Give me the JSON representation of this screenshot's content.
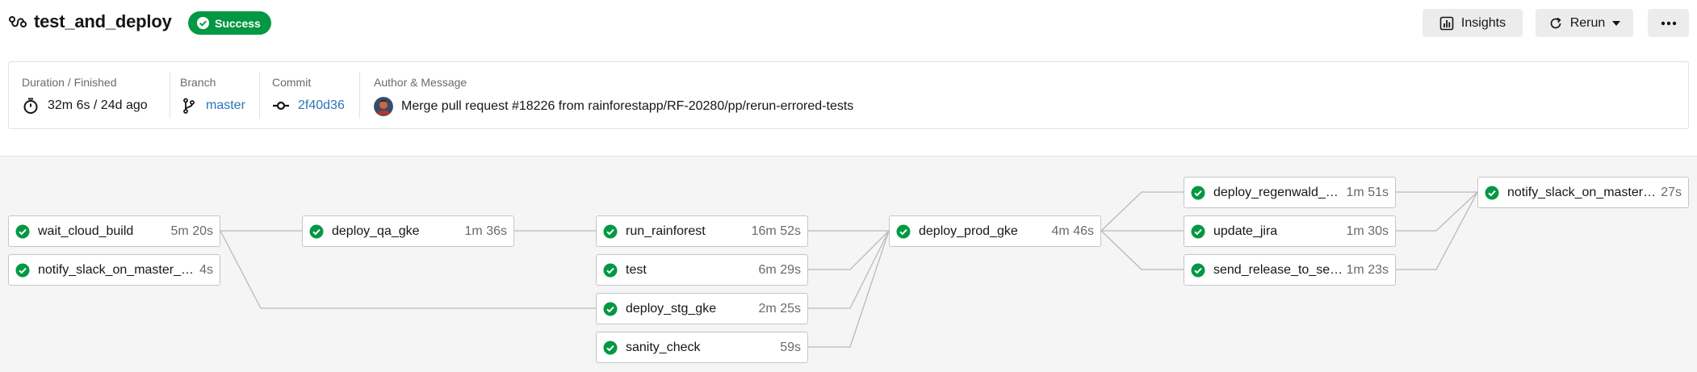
{
  "header": {
    "workflow_name": "test_and_deploy",
    "status": "Success",
    "status_color": "#039843",
    "buttons": {
      "insights": "Insights",
      "rerun": "Rerun",
      "more_icon": "ellipsis-icon"
    }
  },
  "summary": {
    "duration": {
      "label": "Duration / Finished",
      "value": "32m 6s / 24d ago",
      "icon": "stopwatch-icon"
    },
    "branch": {
      "label": "Branch",
      "value": "master",
      "icon": "branch-icon"
    },
    "commit": {
      "label": "Commit",
      "value": "2f40d36",
      "icon": "commit-icon"
    },
    "author": {
      "label": "Author & Message",
      "message": "Merge pull request #18226 from rainforestapp/RF-20280/pp/rerun-errored-tests",
      "icon": "avatar"
    }
  },
  "jobs": [
    {
      "id": "wait",
      "name": "wait_cloud_build",
      "duration": "5m 20s",
      "status": "success"
    },
    {
      "id": "notify1",
      "name": "notify_slack_on_master_re…",
      "duration": "4s",
      "status": "success"
    },
    {
      "id": "qa",
      "name": "deploy_qa_gke",
      "duration": "1m 36s",
      "status": "success"
    },
    {
      "id": "rainforest",
      "name": "run_rainforest",
      "duration": "16m 52s",
      "status": "success"
    },
    {
      "id": "test",
      "name": "test",
      "duration": "6m 29s",
      "status": "success"
    },
    {
      "id": "stg",
      "name": "deploy_stg_gke",
      "duration": "2m 25s",
      "status": "success"
    },
    {
      "id": "sanity",
      "name": "sanity_check",
      "duration": "59s",
      "status": "success"
    },
    {
      "id": "prod",
      "name": "deploy_prod_gke",
      "duration": "4m 46s",
      "status": "success"
    },
    {
      "id": "regen",
      "name": "deploy_regenwald_gke",
      "duration": "1m 51s",
      "status": "success"
    },
    {
      "id": "jira",
      "name": "update_jira",
      "duration": "1m 30s",
      "status": "success"
    },
    {
      "id": "sentry",
      "name": "send_release_to_sentry",
      "duration": "1m 23s",
      "status": "success"
    },
    {
      "id": "notify2",
      "name": "notify_slack_on_master_r…",
      "duration": "27s",
      "status": "success"
    }
  ],
  "colors": {
    "success": "#039843",
    "link": "#2b76b9",
    "edge": "#b9b9b9"
  }
}
